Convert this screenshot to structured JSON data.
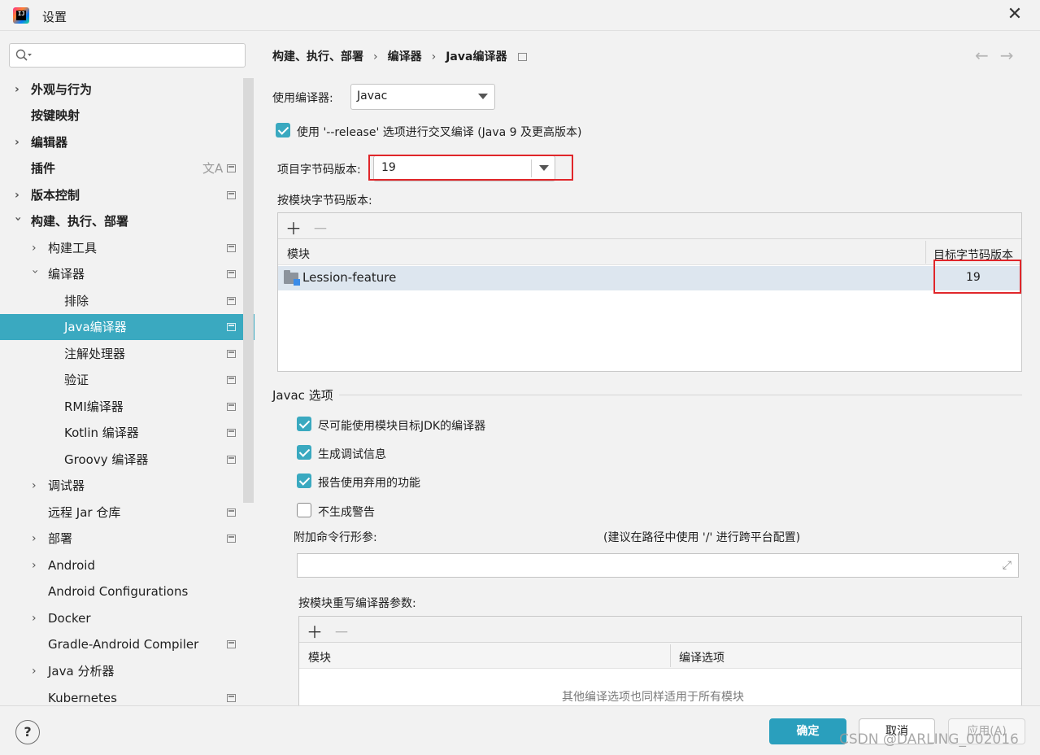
{
  "window": {
    "title": "设置",
    "app_icon_text": "IJ"
  },
  "search": {
    "placeholder": ""
  },
  "sidebar": {
    "items": [
      {
        "label": "外观与行为"
      },
      {
        "label": "按键映射"
      },
      {
        "label": "编辑器"
      },
      {
        "label": "插件"
      },
      {
        "label": "版本控制"
      },
      {
        "label": "构建、执行、部署"
      },
      {
        "label": "构建工具"
      },
      {
        "label": "编译器"
      },
      {
        "label": "排除"
      },
      {
        "label": "Java编译器"
      },
      {
        "label": "注解处理器"
      },
      {
        "label": "验证"
      },
      {
        "label": "RMI编译器"
      },
      {
        "label": "Kotlin 编译器"
      },
      {
        "label": "Groovy 编译器"
      },
      {
        "label": "调试器"
      },
      {
        "label": "远程 Jar 仓库"
      },
      {
        "label": "部署"
      },
      {
        "label": "Android"
      },
      {
        "label": "Android Configurations"
      },
      {
        "label": "Docker"
      },
      {
        "label": "Gradle-Android Compiler"
      },
      {
        "label": "Java 分析器"
      },
      {
        "label": "Kubernetes"
      }
    ],
    "selected": "Java编译器"
  },
  "breadcrumb": {
    "part1": "构建、执行、部署",
    "part2": "编译器",
    "part3": "Java编译器",
    "sep": "›"
  },
  "compiler": {
    "use_compiler_label": "使用编译器:",
    "use_compiler_value": "Javac",
    "release_label": "使用 '--release' 选项进行交叉编译 (Java 9 及更高版本)",
    "release_checked": true,
    "bytecode_label": "项目字节码版本:",
    "bytecode_value": "19",
    "per_module_label": "按模块字节码版本:"
  },
  "module_table": {
    "col_module": "模块",
    "col_target": "目标字节码版本",
    "rows": [
      {
        "module": "Lession-feature",
        "target": "19"
      }
    ]
  },
  "javac": {
    "section_title": "Javac 选项",
    "opt1": "尽可能使用模块目标JDK的编译器",
    "opt1_checked": true,
    "opt2": "生成调试信息",
    "opt2_checked": true,
    "opt3": "报告使用弃用的功能",
    "opt3_checked": true,
    "opt4": "不生成警告",
    "opt4_checked": false,
    "cmdline_label": "附加命令行形参:",
    "cmdline_hint": "(建议在路径中使用 '/' 进行跨平台配置)",
    "cmdline_value": "",
    "override_label": "按模块重写编译器参数:",
    "override_col_module": "模块",
    "override_col_options": "编译选项",
    "override_empty": "其他编译选项也同样适用于所有模块"
  },
  "footer": {
    "help": "?",
    "ok": "确定",
    "cancel": "取消",
    "apply": "应用(A)",
    "watermark": "CSDN @DARLING_002016"
  },
  "colors": {
    "accent": "#3aa9c0",
    "primary_button": "#2a9fbd",
    "highlight_box": "#e0262a"
  }
}
